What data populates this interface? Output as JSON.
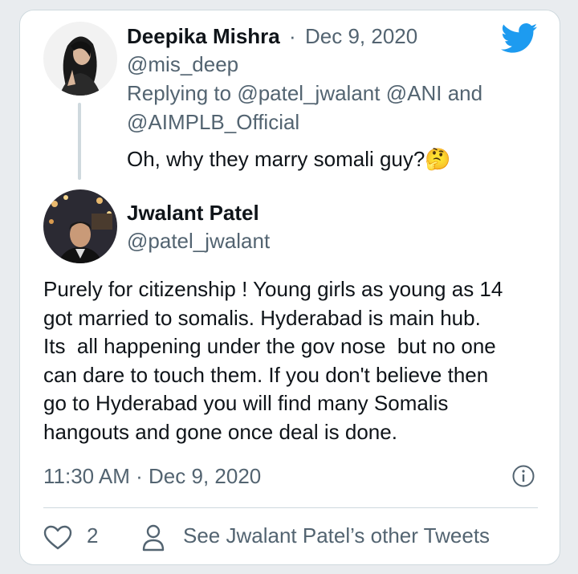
{
  "reply": {
    "author_name": "Deepika Mishra",
    "separator": "·",
    "date": "Dec 9, 2020",
    "handle": "@mis_deep",
    "replying_prefix": "Replying to",
    "replying_mention_1": "@patel_jwalant",
    "replying_mention_2": "@ANI",
    "replying_and": "and",
    "replying_mention_3": "@AIMPLB_Official",
    "text": "Oh, why they marry somali guy?",
    "emoji": "🤔"
  },
  "main": {
    "author_name": "Jwalant Patel",
    "handle": "@patel_jwalant",
    "text_lines": [
      "Purely for citizenship ! Young girls as young as 14",
      "got married to somalis. Hyderabad is main hub.",
      "Its  all happening under the gov nose  but no one",
      "can dare to touch them. If you don't believe then",
      "go to Hyderabad you will find many Somalis",
      "hangouts and gone once deal is done."
    ],
    "timestamp": "11:30 AM · Dec 9, 2020"
  },
  "footer": {
    "like_count": "2",
    "other_tweets": "See Jwalant Patel’s other Tweets"
  },
  "colors": {
    "twitter_blue": "#1d9bf0",
    "secondary_text": "#536471",
    "border": "#cfd9de"
  },
  "icons": [
    "twitter-logo-icon",
    "info-icon",
    "heart-icon",
    "person-icon"
  ]
}
